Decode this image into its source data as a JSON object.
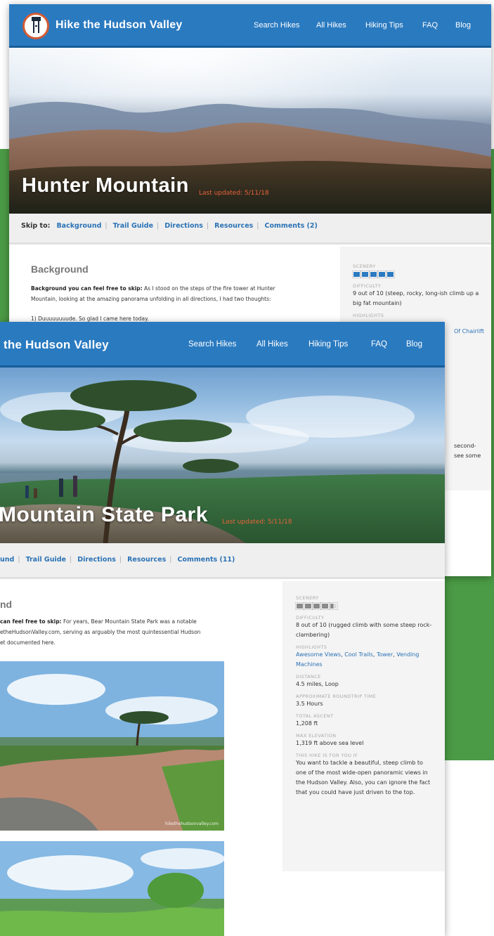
{
  "site": {
    "brand": "Hike the Hudson Valley",
    "brand_partial": "the Hudson Valley"
  },
  "nav": {
    "items": [
      "Search Hikes",
      "All Hikes",
      "Hiking Tips",
      "FAQ",
      "Blog"
    ]
  },
  "back_page": {
    "title": "Hunter Mountain",
    "updated": "Last updated: 5/11/18",
    "skip": {
      "label": "Skip to:",
      "links": [
        "Background",
        "Trail Guide",
        "Directions",
        "Resources",
        "Comments (2)"
      ]
    },
    "background_heading": "Background",
    "background_lead": "Background you can feel free to skip:",
    "background_text": " As I stood on the steps of the fire tower at Hunter Mountain, looking at the amazing panorama unfolding in all directions, I had two thoughts:",
    "thought_1": "1) Duuuuuuuude.  So glad I came here today.",
    "sidebar": {
      "scenery_label": "SCENERY",
      "scenery_stars": 5,
      "difficulty_label": "DIFFICULTY",
      "difficulty": "9 out of 10 (steep, rocky, long-ish climb up a big fat mountain)",
      "highlights_label": "HIGHLIGHTS",
      "highlights_partial": "Of Chairlift",
      "snippet_1": "second-",
      "snippet_2": "see some"
    }
  },
  "front_page": {
    "title": "Mountain State Park",
    "updated": "Last updated: 5/11/18",
    "skip": {
      "first_partial": "und",
      "links": [
        "Trail Guide",
        "Directions",
        "Resources",
        "Comments (11)"
      ]
    },
    "background_heading": "nd",
    "background_lead": "can feel free to skip:",
    "background_line_1": " For years, Bear Mountain State Park was a notable",
    "background_line_2": "etheHudsonValley.com, serving as arguably the most quintessential Hudson",
    "background_line_3": "et documented here.",
    "photo_watermark": "hikethehudsonvalley.com",
    "sidebar": {
      "scenery_label": "SCENERY",
      "scenery_stars": 4.5,
      "difficulty_label": "DIFFICULTY",
      "difficulty": "8 out of 10 (rugged climb with some steep rock-clambering)",
      "highlights_label": "HIGHLIGHTS",
      "highlights": [
        "Awesome Views",
        "Cool Trails",
        "Tower",
        "Vending Machines"
      ],
      "distance_label": "DISTANCE",
      "distance": "4.5 miles, Loop",
      "time_label": "APPROXIMATE ROUNDTRIP TIME",
      "time": "3.5 Hours",
      "ascent_label": "TOTAL ASCENT",
      "ascent": "1,208 ft",
      "elevation_label": "MAX ELEVATION",
      "elevation": "1,319 ft above sea level",
      "for_you_label": "THIS HIKE IS FOR YOU IF",
      "for_you": "You want to tackle a beautiful, steep climb to one of the most wide-open panoramic views in the Hudson Valley. Also, you can ignore the fact that you could have just driven to the top."
    }
  },
  "colors": {
    "nav_blue": "#2a7ac0",
    "link_blue": "#2a72b5",
    "updated_orange": "#e8633a",
    "background_green": "#4b9a45"
  }
}
